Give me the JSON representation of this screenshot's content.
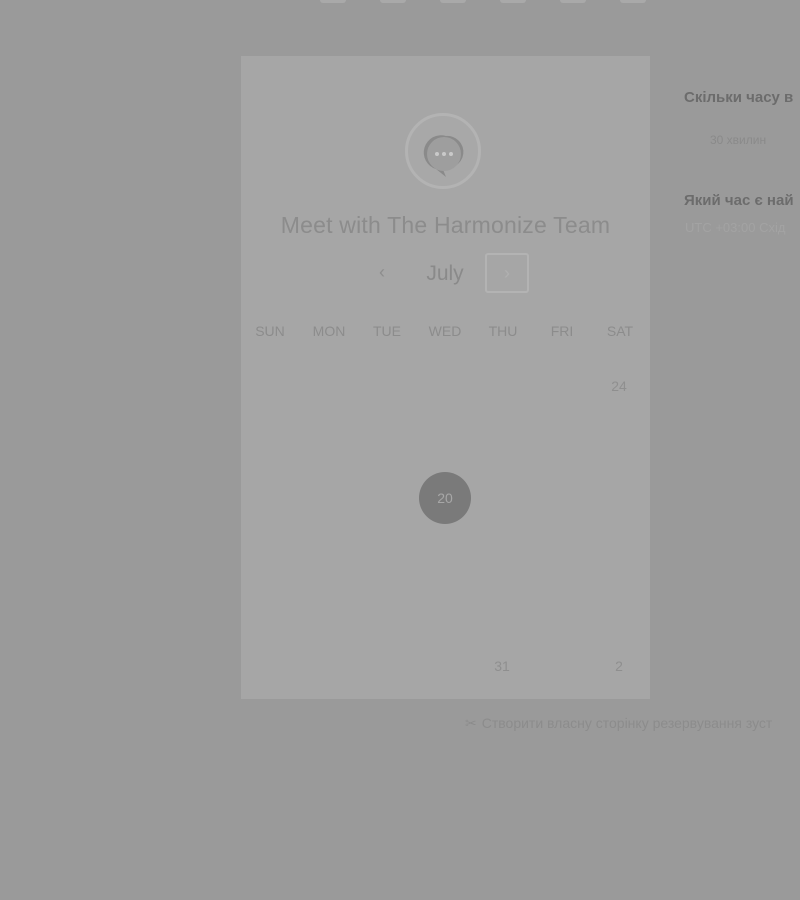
{
  "card": {
    "title": "Meet with The Harmonize Team",
    "month": "July",
    "prev_symbol": "‹",
    "next_symbol": "›",
    "weekdays": [
      "SUN",
      "MON",
      "TUE",
      "WED",
      "THU",
      "FRI",
      "SAT"
    ],
    "days": {
      "sat_first_row": "24",
      "selected": "20",
      "thu_last_row": "31",
      "sat_last_row": "2"
    }
  },
  "side": {
    "question_duration": "Скільки часу в",
    "duration_option": "30 хвилин",
    "question_time": "Який час є най",
    "timezone": "UTC +03:00 Схід"
  },
  "footer": {
    "create_link": "Створити власну сторінку резервування зуст"
  },
  "colors": {
    "overlay_bg": "#9a9a9a",
    "card_bg": "#a6a6a6",
    "selected_day": "#7a7a7a"
  },
  "icons": {
    "logo": "chat-bubble-icon",
    "footer": "scissors-icon"
  }
}
